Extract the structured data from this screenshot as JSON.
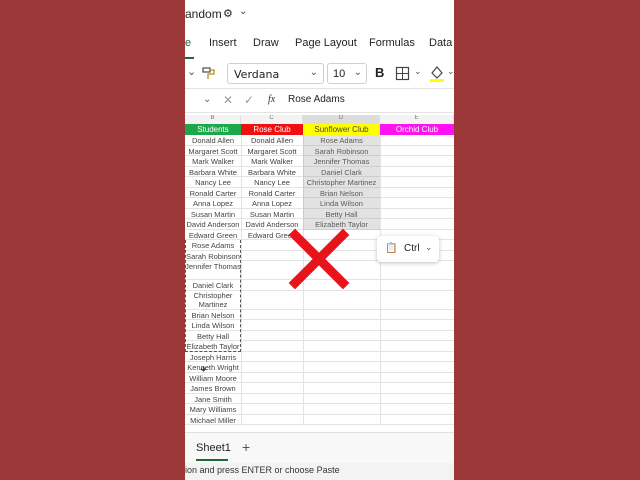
{
  "titlebar": {
    "doc_title": "andom"
  },
  "ribbon": {
    "tabs": [
      "e",
      "Insert",
      "Draw",
      "Page Layout",
      "Formulas",
      "Data"
    ],
    "font_name": "Verdana",
    "font_size": "10",
    "bold_label": "B"
  },
  "formula_bar": {
    "fx": "fx",
    "value": "Rose Adams"
  },
  "grid": {
    "columns": [
      "B",
      "C",
      "D",
      "E"
    ],
    "headers": {
      "students": "Students",
      "rose": "Rose Club",
      "sunflower": "Sunflower Club",
      "orchid": "Orchid Club"
    },
    "colors": {
      "students": "#1ca84a",
      "rose": "#f01010",
      "sunflower": "#ffff00",
      "orchid": "#ff12f0",
      "selection": "#c9c9c9",
      "big_x": "#e8141c"
    },
    "students": [
      "Donald Allen",
      "Margaret Scott",
      "Mark Walker",
      "Barbara White",
      "Nancy Lee",
      "Ronald Carter",
      "Anna Lopez",
      "Susan Martin",
      "David Anderson",
      "Edward Green",
      "Rose Adams",
      "Sarah Robinson",
      "Jennifer Thomas",
      "Daniel Clark",
      "Christopher Martinez",
      "Brian Nelson",
      "Linda Wilson",
      "Betty Hall",
      "Elizabeth Taylor",
      "Joseph Harris",
      "Kenneth Wright",
      "William Moore",
      "James Brown",
      "Jane Smith",
      "Mary Williams",
      "Michael Miller"
    ],
    "rose_club": [
      "Donald Allen",
      "Margaret Scott",
      "Mark Walker",
      "Barbara White",
      "Nancy Lee",
      "Ronald Carter",
      "Anna Lopez",
      "Susan Martin",
      "David Anderson",
      "Edward Green"
    ],
    "sunflower_club": [
      "Rose Adams",
      "Sarah Robinson",
      "Jennifer Thomas",
      "Daniel Clark",
      "Christopher Martinez",
      "Brian Nelson",
      "Linda Wilson",
      "Betty Hall",
      "Elizabeth Taylor"
    ]
  },
  "paste_popup": {
    "label": "Ctrl"
  },
  "sheets": {
    "active": "Sheet1",
    "add": "+"
  },
  "status": {
    "text": "ion and press ENTER or choose Paste"
  }
}
